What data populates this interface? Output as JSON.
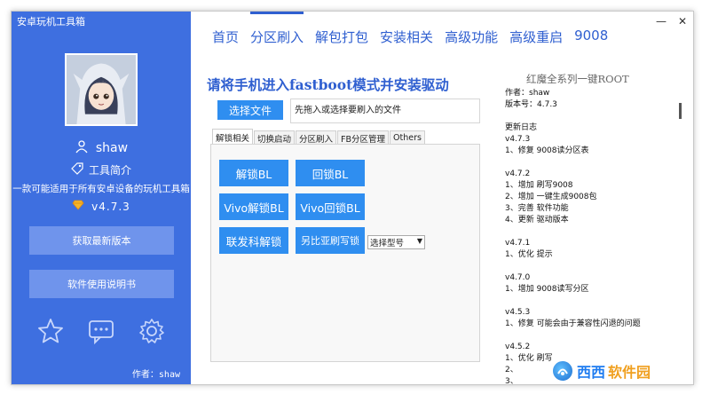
{
  "app": {
    "title": "安卓玩机工具箱"
  },
  "titlebar": {
    "minimize_glyph": "—",
    "close_glyph": "✕"
  },
  "sidebar": {
    "username": "shaw",
    "intro_label": "工具简介",
    "description": "一款可能适用于所有安卓设备的玩机工具箱",
    "version": "v4.7.3",
    "buttons": [
      "获取最新版本",
      "软件使用说明书"
    ],
    "icons": [
      "star-icon",
      "chat-bubble-icon",
      "gear-icon"
    ],
    "author": "作者：shaw"
  },
  "nav": {
    "items": [
      "首页",
      "分区刷入",
      "解包打包",
      "安装相关",
      "高级功能",
      "高级重启",
      "9008"
    ],
    "active_index": 1
  },
  "main": {
    "headline": "请将手机进入fastboot模式并安装驱动",
    "select_file_button": "选择文件",
    "file_input_placeholder": "先拖入或选择要刷入的文件",
    "tabs": [
      "解锁相关",
      "切换启动",
      "分区刷入",
      "FB分区管理",
      "Others"
    ],
    "active_tab_index": 0,
    "buttons": {
      "unlock_bl": "解锁BL",
      "relock_bl": "回锁BL",
      "vivo_unlock_bl": "Vivo解锁BL",
      "vivo_relock_bl": "Vivo回锁BL",
      "mtk_unlock": "联发科解锁",
      "unisoc_flash_lock": "另比亚刷写锁"
    },
    "model_select": {
      "selected": "选择型号"
    }
  },
  "right_panel": {
    "title": "红魔全系列一键ROOT",
    "log_lines": [
      "作者：shaw",
      "版本号：4.7.3",
      "",
      "更新日志",
      "v4.7.3",
      "1、修复 9008读分区表",
      "",
      "v4.7.2",
      "1、增加 刷写9008",
      "2、增加 一键生成9008包",
      "3、完善 软件功能",
      "4、更新 驱动版本",
      "",
      "v4.7.1",
      "1、优化 提示",
      "",
      "v4.7.0",
      "1、增加 9008读写分区",
      "",
      "v4.5.3",
      "1、修复 可能会由于兼容性闪退的问题",
      "",
      "v4.5.2",
      "1、优化 刷写",
      "2、",
      "3、"
    ]
  },
  "watermark": {
    "text_blue": "西西",
    "text_orange": "软件园"
  },
  "colors": {
    "sidebar_bg": "#3e6fe0",
    "accent": "#2f5fd0",
    "button_blue": "#2f8ef0"
  }
}
